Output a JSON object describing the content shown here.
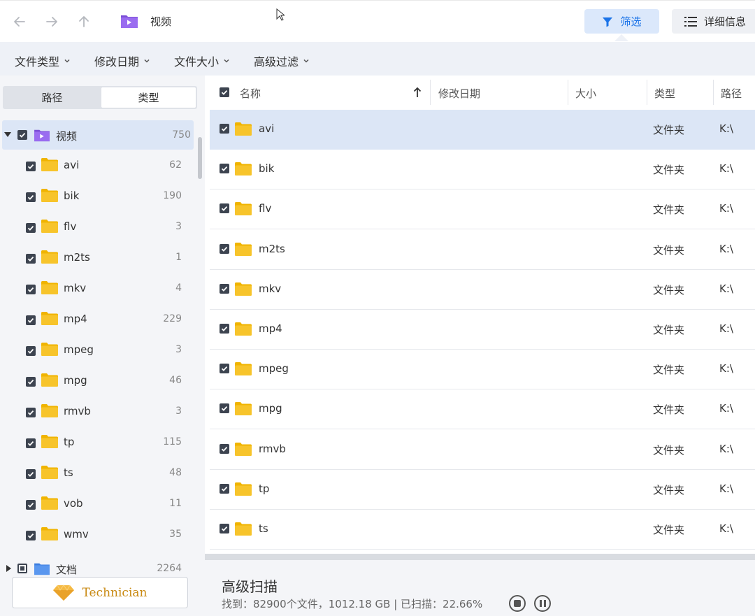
{
  "toolbar": {
    "breadcrumb": "视频",
    "filter_label": "筛选",
    "details_label": "详细信息"
  },
  "filters": [
    "文件类型",
    "修改日期",
    "文件大小",
    "高级过滤"
  ],
  "sidebar": {
    "tab_path": "路径",
    "tab_type": "类型",
    "root": {
      "label": "视频",
      "count": "750"
    },
    "items": [
      {
        "label": "avi",
        "count": "62"
      },
      {
        "label": "bik",
        "count": "190"
      },
      {
        "label": "flv",
        "count": "3"
      },
      {
        "label": "m2ts",
        "count": "1"
      },
      {
        "label": "mkv",
        "count": "4"
      },
      {
        "label": "mp4",
        "count": "229"
      },
      {
        "label": "mpeg",
        "count": "3"
      },
      {
        "label": "mpg",
        "count": "46"
      },
      {
        "label": "rmvb",
        "count": "3"
      },
      {
        "label": "tp",
        "count": "115"
      },
      {
        "label": "ts",
        "count": "48"
      },
      {
        "label": "vob",
        "count": "11"
      },
      {
        "label": "wmv",
        "count": "35"
      }
    ],
    "next_root": {
      "label": "文档",
      "count": "2264"
    },
    "technician_label": "Technician"
  },
  "table": {
    "headers": {
      "name": "名称",
      "modified": "修改日期",
      "size": "大小",
      "type": "类型",
      "path": "路径"
    },
    "rows": [
      {
        "name": "avi",
        "type": "文件夹",
        "path": "K:\\"
      },
      {
        "name": "bik",
        "type": "文件夹",
        "path": "K:\\"
      },
      {
        "name": "flv",
        "type": "文件夹",
        "path": "K:\\"
      },
      {
        "name": "m2ts",
        "type": "文件夹",
        "path": "K:\\"
      },
      {
        "name": "mkv",
        "type": "文件夹",
        "path": "K:\\"
      },
      {
        "name": "mp4",
        "type": "文件夹",
        "path": "K:\\"
      },
      {
        "name": "mpeg",
        "type": "文件夹",
        "path": "K:\\"
      },
      {
        "name": "mpg",
        "type": "文件夹",
        "path": "K:\\"
      },
      {
        "name": "rmvb",
        "type": "文件夹",
        "path": "K:\\"
      },
      {
        "name": "tp",
        "type": "文件夹",
        "path": "K:\\"
      },
      {
        "name": "ts",
        "type": "文件夹",
        "path": "K:\\"
      }
    ]
  },
  "status": {
    "title": "高级扫描",
    "summary": "找到：82900个文件，1012.18 GB | 已扫描：22.66%"
  },
  "icons": {
    "back": "arrow-left-icon",
    "forward": "arrow-right-icon",
    "up": "arrow-up-icon",
    "video_folder": "video-folder-icon",
    "filter": "funnel-icon",
    "details": "list-icon",
    "folder": "folder-icon",
    "technician": "diamond-icon"
  },
  "colors": {
    "accent": "#1a73e8",
    "selection": "#dce6f6",
    "folder": "#f7c42b",
    "video_folder": "#7b4fd6",
    "doc_folder": "#3b7de0"
  }
}
